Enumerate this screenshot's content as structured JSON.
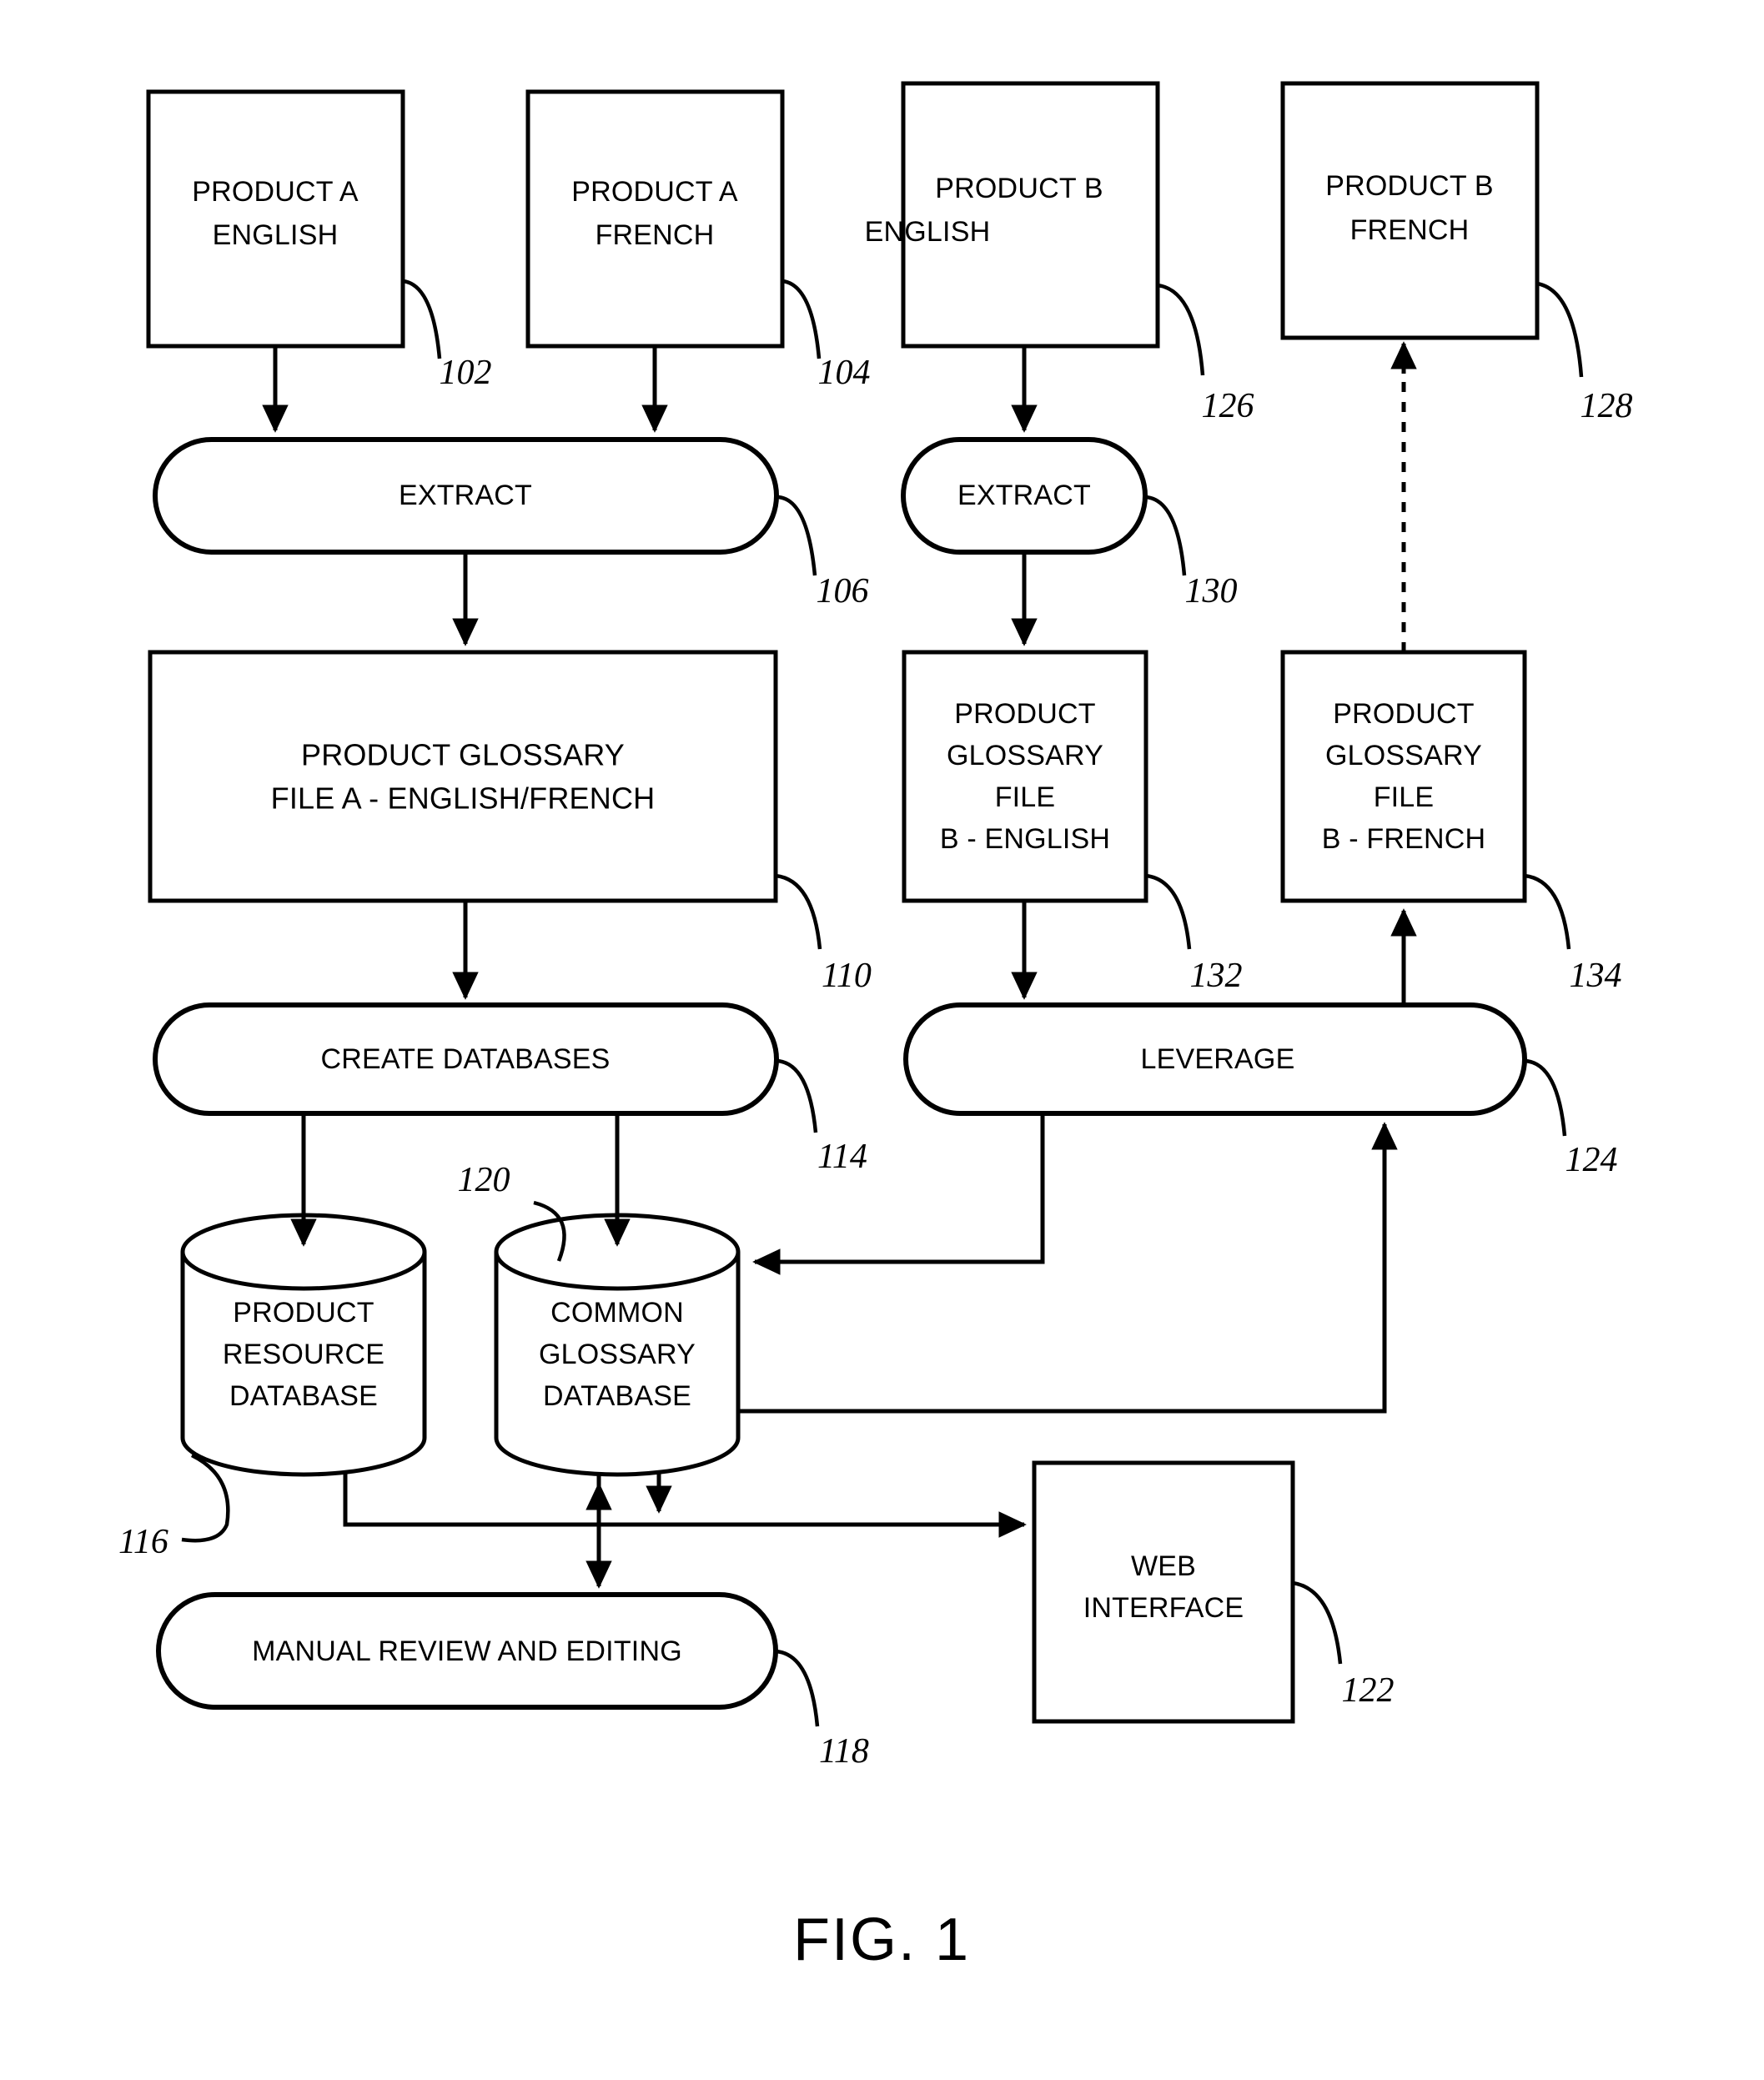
{
  "figure": {
    "caption": "FIG. 1",
    "title": "Glossary extraction and leveraging process flow"
  },
  "nodes": {
    "product_a_english": {
      "label_line1": "PRODUCT A",
      "label_line2": "ENGLISH",
      "ref": "102",
      "shape": "rect"
    },
    "product_a_french": {
      "label_line1": "PRODUCT A",
      "label_line2": "FRENCH",
      "ref": "104",
      "shape": "rect"
    },
    "product_b_english": {
      "label_line1": "PRODUCT B",
      "label_line2": "ENGLISH",
      "ref": "126",
      "shape": "rect"
    },
    "product_b_french": {
      "label_line1": "PRODUCT B",
      "label_line2": "FRENCH",
      "ref": "128",
      "shape": "rect"
    },
    "extract_a": {
      "label": "EXTRACT",
      "ref": "106",
      "shape": "stadium"
    },
    "extract_b": {
      "label": "EXTRACT",
      "ref": "130",
      "shape": "stadium"
    },
    "glossary_file_a": {
      "label_line1": "PRODUCT GLOSSARY",
      "label_line2": "FILE A - ENGLISH/FRENCH",
      "ref": "110",
      "shape": "rect"
    },
    "glossary_file_b_english": {
      "label_line1": "PRODUCT",
      "label_line2": "GLOSSARY",
      "label_line3": "FILE",
      "label_line4": "B - ENGLISH",
      "ref": "132",
      "shape": "rect"
    },
    "glossary_file_b_french": {
      "label_line1": "PRODUCT",
      "label_line2": "GLOSSARY",
      "label_line3": "FILE",
      "label_line4": "B - FRENCH",
      "ref": "134",
      "shape": "rect"
    },
    "create_databases": {
      "label": "CREATE DATABASES",
      "ref": "114",
      "shape": "stadium"
    },
    "leverage": {
      "label": "LEVERAGE",
      "ref": "124",
      "shape": "stadium"
    },
    "product_resource_database": {
      "label_line1": "PRODUCT",
      "label_line2": "RESOURCE",
      "label_line3": "DATABASE",
      "ref": "116",
      "shape": "cylinder"
    },
    "common_glossary_database": {
      "label_line1": "COMMON",
      "label_line2": "GLOSSARY",
      "label_line3": "DATABASE",
      "ref": "120",
      "shape": "cylinder"
    },
    "manual_review": {
      "label": "MANUAL REVIEW AND EDITING",
      "ref": "118",
      "shape": "stadium"
    },
    "web_interface": {
      "label_line1": "WEB",
      "label_line2": "INTERFACE",
      "ref": "122",
      "shape": "rect"
    }
  },
  "chart_data": {
    "type": "diagram",
    "title": "FIG. 1",
    "nodes": [
      {
        "id": "102",
        "text": "PRODUCT A ENGLISH",
        "shape": "rect"
      },
      {
        "id": "104",
        "text": "PRODUCT A FRENCH",
        "shape": "rect"
      },
      {
        "id": "126",
        "text": "PRODUCT B ENGLISH",
        "shape": "rect"
      },
      {
        "id": "128",
        "text": "PRODUCT B FRENCH",
        "shape": "rect"
      },
      {
        "id": "106",
        "text": "EXTRACT",
        "shape": "stadium"
      },
      {
        "id": "130",
        "text": "EXTRACT",
        "shape": "stadium"
      },
      {
        "id": "110",
        "text": "PRODUCT GLOSSARY FILE A - ENGLISH/FRENCH",
        "shape": "rect"
      },
      {
        "id": "132",
        "text": "PRODUCT GLOSSARY FILE B - ENGLISH",
        "shape": "rect"
      },
      {
        "id": "134",
        "text": "PRODUCT GLOSSARY FILE B - FRENCH",
        "shape": "rect"
      },
      {
        "id": "114",
        "text": "CREATE DATABASES",
        "shape": "stadium"
      },
      {
        "id": "124",
        "text": "LEVERAGE",
        "shape": "stadium"
      },
      {
        "id": "116",
        "text": "PRODUCT RESOURCE DATABASE",
        "shape": "cylinder"
      },
      {
        "id": "120",
        "text": "COMMON GLOSSARY DATABASE",
        "shape": "cylinder"
      },
      {
        "id": "118",
        "text": "MANUAL REVIEW AND EDITING",
        "shape": "stadium"
      },
      {
        "id": "122",
        "text": "WEB INTERFACE",
        "shape": "rect"
      }
    ],
    "edges": [
      {
        "from": "102",
        "to": "106",
        "style": "solid",
        "arrow": "end"
      },
      {
        "from": "104",
        "to": "106",
        "style": "solid",
        "arrow": "end"
      },
      {
        "from": "106",
        "to": "110",
        "style": "solid",
        "arrow": "end"
      },
      {
        "from": "110",
        "to": "114",
        "style": "solid",
        "arrow": "end"
      },
      {
        "from": "114",
        "to": "116",
        "style": "solid",
        "arrow": "end"
      },
      {
        "from": "114",
        "to": "120",
        "style": "solid",
        "arrow": "end"
      },
      {
        "from": "126",
        "to": "130",
        "style": "solid",
        "arrow": "end"
      },
      {
        "from": "130",
        "to": "132",
        "style": "solid",
        "arrow": "end"
      },
      {
        "from": "132",
        "to": "124",
        "style": "solid",
        "arrow": "end"
      },
      {
        "from": "124",
        "to": "120",
        "style": "solid",
        "arrow": "end"
      },
      {
        "from": "120",
        "to": "124",
        "style": "solid",
        "arrow": "end"
      },
      {
        "from": "124",
        "to": "134",
        "style": "solid",
        "arrow": "end"
      },
      {
        "from": "134",
        "to": "128",
        "style": "dashed",
        "arrow": "end"
      },
      {
        "from": "116",
        "to": "122",
        "style": "solid",
        "arrow": "end"
      },
      {
        "from": "120",
        "to": "118",
        "style": "solid",
        "arrow": "both"
      },
      {
        "from": "118",
        "to": "120",
        "style": "solid",
        "arrow": "end"
      }
    ]
  }
}
